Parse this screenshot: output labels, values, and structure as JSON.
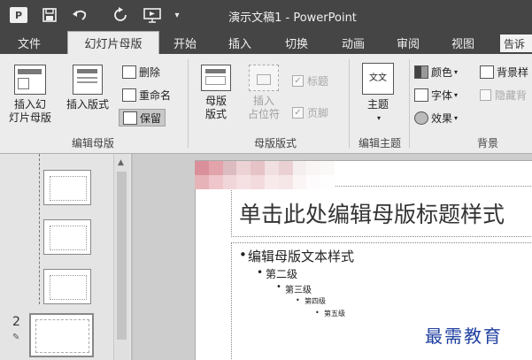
{
  "window": {
    "title": "演示文稿1 - PowerPoint",
    "app_logo": "P"
  },
  "qat": [
    "save-icon",
    "undo-icon",
    "redo-icon",
    "present-from-start-icon",
    "customize-arrow-icon"
  ],
  "tabs": [
    {
      "label": "文件",
      "active": false
    },
    {
      "label": "幻灯片母版",
      "active": true
    },
    {
      "label": "开始",
      "active": false
    },
    {
      "label": "插入",
      "active": false
    },
    {
      "label": "切换",
      "active": false
    },
    {
      "label": "动画",
      "active": false
    },
    {
      "label": "审阅",
      "active": false
    },
    {
      "label": "视图",
      "active": false
    }
  ],
  "tell_me": "告诉",
  "ribbon": {
    "edit_master": {
      "label": "编辑母版",
      "insert_slide_master": [
        "插入幻",
        "灯片母版"
      ],
      "insert_layout": "插入版式",
      "delete": "删除",
      "rename": "重命名",
      "preserve": "保留"
    },
    "master_layout": {
      "label": "母版版式",
      "master_layout_btn": [
        "母版",
        "版式"
      ],
      "insert_placeholder": [
        "插入",
        "占位符"
      ],
      "title_chk": "标题",
      "footer_chk": "页脚"
    },
    "edit_theme": {
      "label": "编辑主题",
      "themes": "主题",
      "theme_icon_text": "文文"
    },
    "background": {
      "label": "背景",
      "colors": "颜色",
      "fonts": "字体",
      "effects": "效果",
      "background_styles": "背景样",
      "hide_background": "隐藏背"
    }
  },
  "thumbnails": {
    "slide_number": "2"
  },
  "slide": {
    "title": "单击此处编辑母版标题样式",
    "levels": [
      "编辑母版文本样式",
      "第二级",
      "第三级",
      "第四级",
      "第五级"
    ]
  },
  "watermark": "最需教育",
  "colors": {
    "titlebar": "#454545",
    "ribbon": "#ececec",
    "watermark": "#1f3fa0"
  }
}
